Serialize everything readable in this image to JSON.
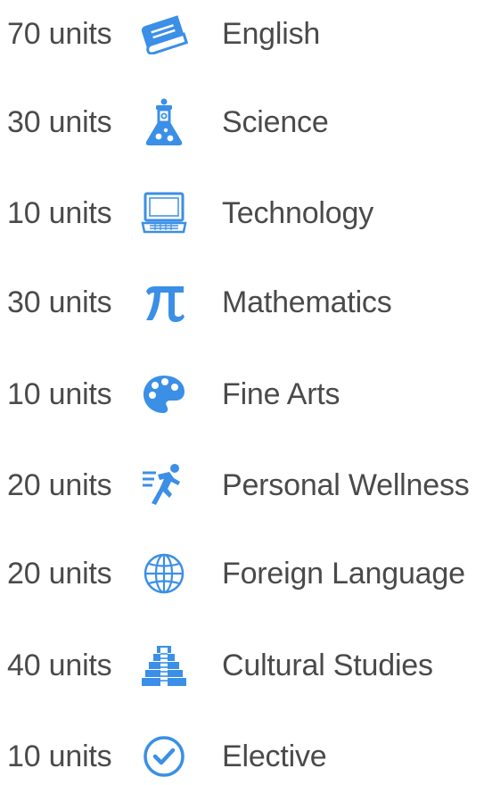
{
  "accent_color": "#3b8fe6",
  "text_color": "#4a4a4a",
  "requirements": [
    {
      "units": "70 units",
      "subject": "English",
      "icon": "book-icon"
    },
    {
      "units": "30 units",
      "subject": "Science",
      "icon": "flask-icon"
    },
    {
      "units": "10 units",
      "subject": "Technology",
      "icon": "laptop-icon"
    },
    {
      "units": "30 units",
      "subject": "Mathematics",
      "icon": "pi-icon"
    },
    {
      "units": "10 units",
      "subject": "Fine Arts",
      "icon": "palette-icon"
    },
    {
      "units": "20 units",
      "subject": "Personal Wellness",
      "icon": "running-icon"
    },
    {
      "units": "20 units",
      "subject": "Foreign Language",
      "icon": "globe-icon"
    },
    {
      "units": "40 units",
      "subject": "Cultural Studies",
      "icon": "pyramid-icon"
    },
    {
      "units": "10 units",
      "subject": "Elective",
      "icon": "check-circle-icon"
    }
  ]
}
